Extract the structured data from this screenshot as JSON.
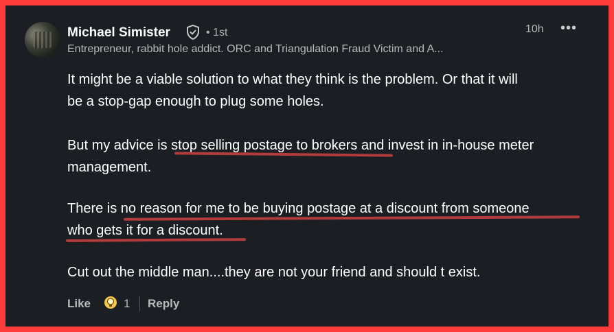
{
  "comment": {
    "author_name": "Michael Simister",
    "degree": "• 1st",
    "headline": "Entrepreneur, rabbit hole addict. ORC and Triangulation Fraud Victim and A...",
    "time": "10h",
    "more_label": "•••",
    "paragraphs": {
      "p1_line1": "It might be a viable solution to what they think is the problem. Or that it will",
      "p1_line2": "be a stop-gap enough to plug some holes.",
      "p2_line1": "But my advice is stop selling postage to brokers and invest in in-house meter",
      "p2_line2": "management.",
      "p3_line1": "There is no reason for me to be buying postage at a discount from someone",
      "p3_line2": "who gets it for a discount.",
      "p4_line1": "Cut out the middle man....they are not your friend and should t exist."
    },
    "actions": {
      "like_label": "Like",
      "reaction_count": "1",
      "reply_label": "Reply"
    },
    "reaction_icon": "insightful-bulb-icon",
    "colors": {
      "frame_border": "#ff3b3b",
      "background": "#1b1f23",
      "underline": "#b23b3b",
      "reaction": "#f5c84b"
    }
  }
}
